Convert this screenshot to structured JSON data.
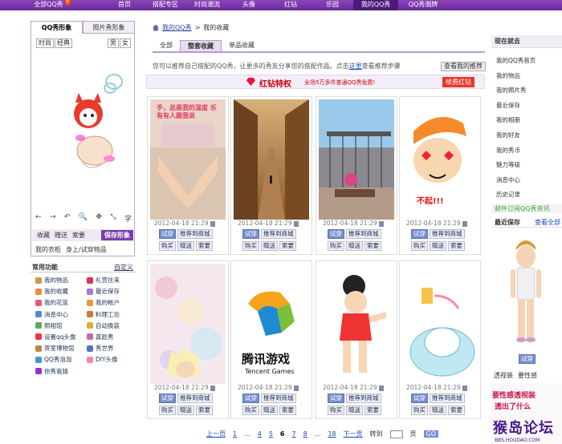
{
  "topnav": [
    {
      "label": "全部QQ秀",
      "hot": "热",
      "width": 130
    },
    {
      "label": "首页",
      "width": 50
    },
    {
      "label": "搭配专区",
      "width": 52
    },
    {
      "label": "时尚潮流",
      "width": 52
    },
    {
      "label": "头像",
      "width": 52
    },
    {
      "label": "红钻",
      "width": 52
    },
    {
      "label": "乐园",
      "width": 52
    },
    {
      "label": "我的QQ秀",
      "width": 56,
      "active": true
    },
    {
      "label": "QQ秀潮牌",
      "width": 62
    }
  ],
  "left": {
    "tabs": [
      "QQ秀形象",
      "照片秀形象"
    ],
    "gender_tabs": [
      "时尚",
      "经典"
    ],
    "sex_tabs": [
      "男",
      "女"
    ],
    "tools": [
      "←",
      "→",
      "↶",
      "🔍",
      "✥",
      "⤡",
      "字"
    ],
    "actions": [
      "收藏",
      "赠送",
      "索要",
      "保存形象"
    ],
    "wardrobe": [
      "我的衣柜",
      "身上/试穿物品"
    ]
  },
  "functions": {
    "title": "常用功能",
    "edit": "自定义",
    "items": [
      {
        "label": "我的物品",
        "color": "#c94"
      },
      {
        "label": "礼赏往来",
        "color": "#d35"
      },
      {
        "label": "我的收藏",
        "color": "#e84"
      },
      {
        "label": "最近保存",
        "color": "#a7c"
      },
      {
        "label": "我的花篮",
        "color": "#e57"
      },
      {
        "label": "我的帐户",
        "color": "#e93"
      },
      {
        "label": "消息中心",
        "color": "#58c"
      },
      {
        "label": "料理工坊",
        "color": "#c73"
      },
      {
        "label": "照相馆",
        "color": "#6a5"
      },
      {
        "label": "自动换装",
        "color": "#da3"
      },
      {
        "label": "设置qq头像",
        "color": "#e34"
      },
      {
        "label": "真脸秀",
        "color": "#c6a"
      },
      {
        "label": "贺室博物馆",
        "color": "#b84"
      },
      {
        "label": "秀世界",
        "color": "#57b"
      },
      {
        "label": "QQ秀泡泡",
        "color": "#49c"
      },
      {
        "label": "DIY头像",
        "color": "#e8a"
      },
      {
        "label": "你秀我猜",
        "color": "#93c"
      }
    ]
  },
  "center": {
    "breadcrumb": [
      "我的QQ秀",
      ">",
      "我的收藏"
    ],
    "tabs": [
      "全部",
      "整套收藏",
      "单品收藏"
    ],
    "intro_pre": "您可以推荐自己搭配的QQ秀，让更多的秀友分享您的搭配作品。点击",
    "intro_link": "这里",
    "intro_post": "查看推荐步骤",
    "view_recommend": "查看我的推荐",
    "promo_title": "红钻特权",
    "promo_sub": "全场5万多件普通QQ秀免费!",
    "promo_btn": "续费红钻",
    "cards": [
      {
        "date": "2012-04-18 21:29",
        "caption": "手，总是我的温度 乐有有人跟我说"
      },
      {
        "date": "2012-04-18 21:29"
      },
      {
        "date": "2012-04-18 21:29"
      },
      {
        "date": "2012-04-18 21:29",
        "caption": "不起!!!"
      },
      {
        "date": "2012-04-18 21:29"
      },
      {
        "date": "2012-04-18 21:29",
        "caption": "腾讯游戏",
        "caption2": "Tencent Games"
      },
      {
        "date": "2012-04-18 21:29"
      },
      {
        "date": "2012-04-18 21:29"
      }
    ],
    "card_buttons": {
      "try": "试穿",
      "recommend": "推荐到商城",
      "buy": "购买",
      "gift": "赠送",
      "ask": "索要"
    },
    "pager": {
      "prev": "上一页",
      "pages": [
        "1",
        "...",
        "4",
        "5",
        "6",
        "7",
        "8",
        "...",
        "18"
      ],
      "current": "6",
      "next": "下一页",
      "goto": "转到",
      "page_unit": "页",
      "go": "GO"
    }
  },
  "right": {
    "now_title": "现在就去",
    "links": [
      "我的QQ秀首页",
      "我的物品",
      "我的照片秀",
      "最近保存",
      "我的相册",
      "我的好友",
      "我的秀币",
      "魅力等级",
      "消息中心",
      "历史记录"
    ],
    "mail_sub": "邮件订阅QQ秀资讯",
    "recent_title": "最近保存",
    "view_all": "查看全部",
    "try": "试穿",
    "bottom_tabs": [
      "透视装",
      "要性感"
    ],
    "ad_line1": "要性感",
    "ad_line2": "透视装",
    "ad_line3": "透出了什么",
    "forum_logo": "猴岛论坛",
    "forum_url": "BBS.HOUDAO.COM"
  }
}
